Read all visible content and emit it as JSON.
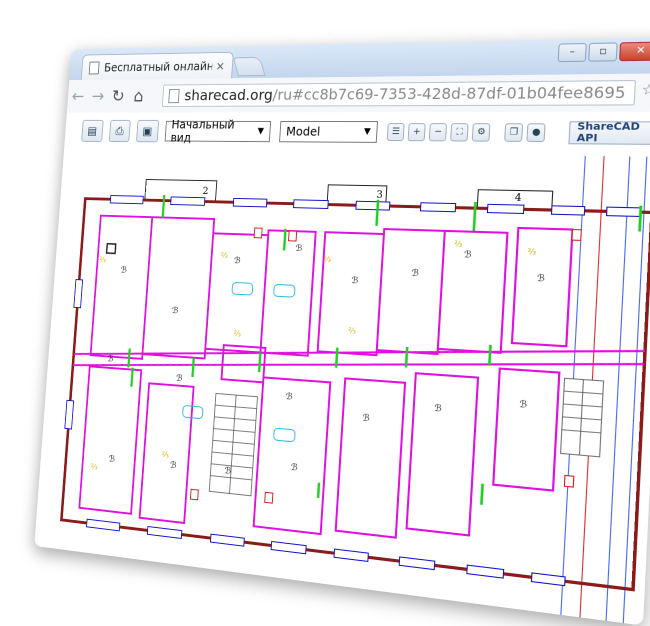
{
  "browser": {
    "tab_title": "Бесплатный онлайн САГ",
    "tab_close": "×",
    "url_host": "sharecad.org",
    "url_path": "/ru#cc8b7c69-7353-428d-87df-01b04fee8695"
  },
  "toolbar": {
    "view_select": "Начальный вид",
    "layout_select": "Model",
    "api_button": "ShareCAD API"
  },
  "drawing": {
    "axis_labels": [
      "2",
      "3",
      "4"
    ],
    "colors": {
      "walls": "#8b1a1a",
      "partitions": "#e010e0",
      "windows": "#1414c8",
      "doors": "#22cc22",
      "annotations": "#e0b000",
      "blue_lines": "#4a6cf0",
      "red_lines": "#e03030"
    }
  }
}
